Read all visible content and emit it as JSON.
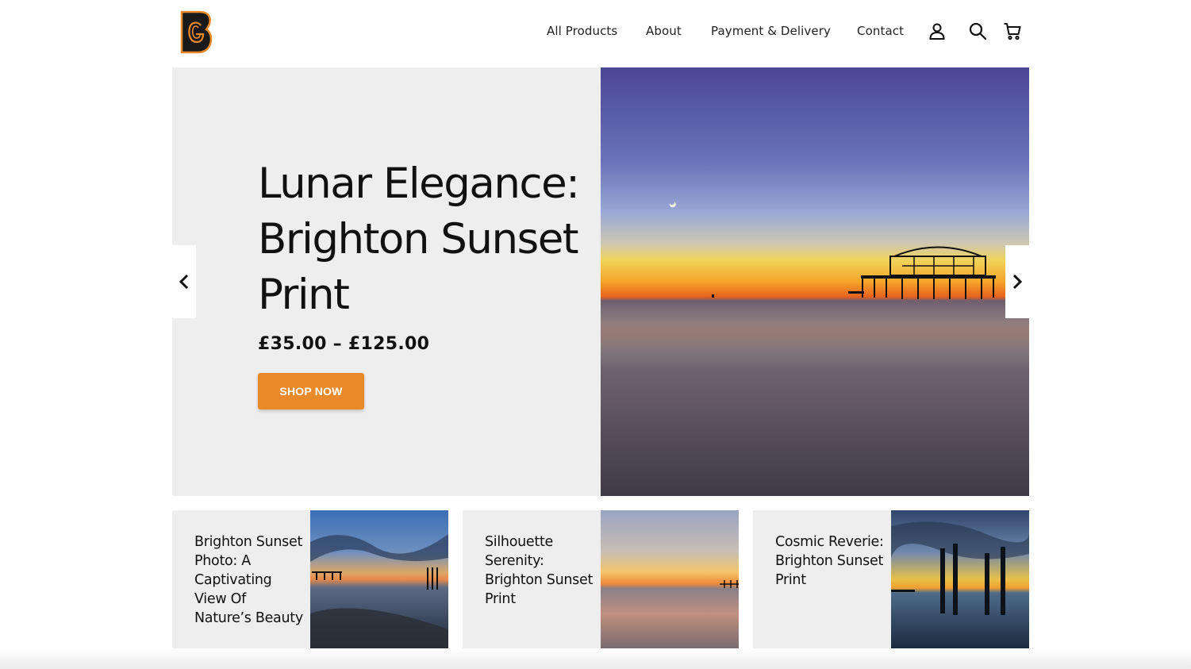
{
  "brand": {
    "logo_letter": "B",
    "logo_inner_letter": "G",
    "accent_color": "#e9892a",
    "logo_bg": "#1a1a1a"
  },
  "nav": {
    "links": [
      "All Products",
      "About",
      "Payment & Delivery",
      "Contact"
    ],
    "icons": [
      "user-icon",
      "search-icon",
      "cart-icon"
    ]
  },
  "hero": {
    "title": "Lunar Elegance: Brighton Sunset Print",
    "price": "£35.00 – £125.00",
    "cta_label": "SHOP NOW"
  },
  "carousel": {
    "prev_icon": "chevron-left-icon",
    "next_icon": "chevron-right-icon"
  },
  "cards": [
    {
      "title": "Brighton Sunset Photo: A Captivating View Of Nature’s Beauty"
    },
    {
      "title": "Silhouette Serenity: Brighton Sunset Print"
    },
    {
      "title": "Cosmic Reverie: Brighton Sunset Print"
    }
  ]
}
